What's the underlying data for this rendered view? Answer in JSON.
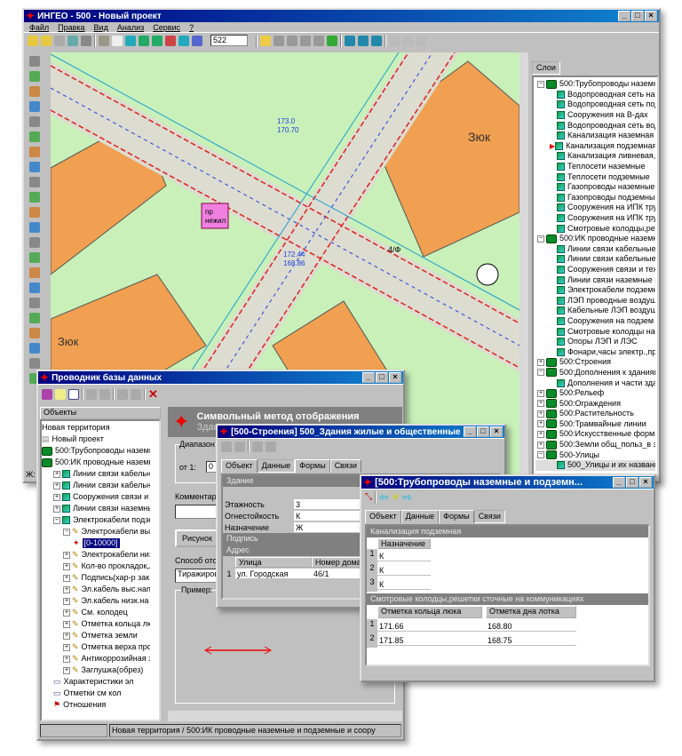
{
  "main_window": {
    "title": "ИНГЕО - 500 - Новый проект",
    "menu": [
      "Файл",
      "Правка",
      "Вид",
      "Анализ",
      "Сервис",
      "?"
    ],
    "scale_value": "522",
    "status_left": "Ж: 1"
  },
  "map": {
    "labels": [
      "Зюк",
      "Зюк",
      "пр",
      "нежил",
      "4/Ф",
      "173.0",
      "170.70",
      "172.44",
      "168.86"
    ],
    "colors": {
      "background": "#c8f0b8",
      "building": "#f0a050",
      "road": "#d8d8c8",
      "pipe": "#e02020",
      "network": "#2040e0"
    }
  },
  "layers_panel": {
    "tab": "Слои",
    "items": [
      {
        "label": "500:Трубопроводы наземные",
        "level": 0,
        "group": true
      },
      {
        "label": "Водопроводная сеть наз",
        "level": 1
      },
      {
        "label": "Водопроводная сеть под",
        "level": 1
      },
      {
        "label": "Сооружения на В-дах",
        "level": 1
      },
      {
        "label": "Водопроводная сеть вод",
        "level": 1
      },
      {
        "label": "Канализация наземная",
        "level": 1
      },
      {
        "label": "Канализация подземная",
        "level": 1,
        "flag": true
      },
      {
        "label": "Канализация ливневая,д",
        "level": 1
      },
      {
        "label": "Теплосети наземные",
        "level": 1
      },
      {
        "label": "Теплосети подземные",
        "level": 1
      },
      {
        "label": "Газопроводы наземные",
        "level": 1
      },
      {
        "label": "Газопроводы подземные",
        "level": 1
      },
      {
        "label": "Сооружения на ИПК труб",
        "level": 1
      },
      {
        "label": "Сооружения на ИПК труб",
        "level": 1
      },
      {
        "label": "Смотровые колодцы,реш",
        "level": 1
      },
      {
        "label": "500:ИК проводные наземные",
        "level": 0,
        "group": true
      },
      {
        "label": "Линии связи кабельные",
        "level": 1
      },
      {
        "label": "Линии связи кабельные",
        "level": 1
      },
      {
        "label": "Сооружения связи и тех",
        "level": 1
      },
      {
        "label": "Линии связи наземные г",
        "level": 1
      },
      {
        "label": "Электрокабели подземн",
        "level": 1
      },
      {
        "label": "ЛЭП проводные воздуш",
        "level": 1
      },
      {
        "label": "Кабельные ЛЭП воздуш",
        "level": 1
      },
      {
        "label": "Сооружения на подзем",
        "level": 1
      },
      {
        "label": "Смотровые колодцы на к",
        "level": 1
      },
      {
        "label": "Опоры ЛЭП и ЛЭС",
        "level": 1
      },
      {
        "label": "Фонари,часы электр.,пр",
        "level": 1
      },
      {
        "label": "500:Строения",
        "level": 0,
        "group": true
      },
      {
        "label": "500:Дополнения к зданиям,",
        "level": 0,
        "group": true
      },
      {
        "label": "Дополнения и части здан",
        "level": 1
      },
      {
        "label": "500:Рельеф",
        "level": 0,
        "group": true
      },
      {
        "label": "500:Ограждения",
        "level": 0,
        "group": true
      },
      {
        "label": "500:Растительность",
        "level": 0,
        "group": true
      },
      {
        "label": "500:Трамвайные линии",
        "level": 0,
        "group": true
      },
      {
        "label": "500:Искусственные формы р",
        "level": 0,
        "group": true
      },
      {
        "label": "500:Земли общ_польз_в зас",
        "level": 0,
        "group": true
      },
      {
        "label": "500-Улицы",
        "level": 0,
        "group": true
      },
      {
        "label": "500_Улицы и их названи",
        "level": 1,
        "selected": true
      }
    ]
  },
  "explorer": {
    "title": "Проводник базы данных",
    "tree_header": "Объекты",
    "tree": [
      {
        "label": "Новая территория",
        "level": 0,
        "icon": "none"
      },
      {
        "label": "Новый проект",
        "level": 0,
        "icon": "project"
      },
      {
        "label": "500:Трубопроводы наземн",
        "level": 0,
        "icon": "group"
      },
      {
        "label": "500:ИК проводные наземн",
        "level": 0,
        "icon": "group"
      },
      {
        "label": "Линии связи кабельн",
        "level": 1,
        "icon": "layer"
      },
      {
        "label": "Линии связи кабельн",
        "level": 1,
        "icon": "layer"
      },
      {
        "label": "Сооружения связи и те",
        "level": 1,
        "icon": "layer"
      },
      {
        "label": "Линии связи наземны",
        "level": 1,
        "icon": "layer"
      },
      {
        "label": "Электрокабели подзем",
        "level": 1,
        "icon": "layer"
      },
      {
        "label": "Электрокабели вы",
        "level": 2,
        "icon": "pen"
      },
      {
        "label": "[0-10000]",
        "level": 3,
        "icon": "star",
        "selected": true
      },
      {
        "label": "Электрокабели низ",
        "level": 2,
        "icon": "pen"
      },
      {
        "label": "Кол-во прокладок,л",
        "level": 2,
        "icon": "pen"
      },
      {
        "label": "Подпись(хар-р зак.",
        "level": 2,
        "icon": "pen"
      },
      {
        "label": "Эл.кабель выс.нап",
        "level": 2,
        "icon": "pen"
      },
      {
        "label": "Эл.кабель низк.на",
        "level": 2,
        "icon": "pen"
      },
      {
        "label": "См. колодец",
        "level": 2,
        "icon": "pen"
      },
      {
        "label": "Отметка кольца лю",
        "level": 2,
        "icon": "pen"
      },
      {
        "label": "Отметка земли",
        "level": 2,
        "icon": "pen"
      },
      {
        "label": "Отметка верха про",
        "level": 2,
        "icon": "pen"
      },
      {
        "label": "Антикоррозийная з",
        "level": 2,
        "icon": "pen"
      },
      {
        "label": "Заглушка(обрез)",
        "level": 2,
        "icon": "pen"
      },
      {
        "label": "Характеристики эл",
        "level": 1,
        "icon": "table"
      },
      {
        "label": "Отметки см кол",
        "level": 1,
        "icon": "table"
      },
      {
        "label": "Отношения",
        "level": 1,
        "icon": "rel"
      }
    ],
    "detail": {
      "title": "Символьный метод отображения",
      "subtitle": "Здания",
      "range_label": "Диапазон",
      "from_label": "от 1:",
      "from_value": "0",
      "comment_label": "Комментарий",
      "picture_button": "Рисунок",
      "method_label": "Способ отображения",
      "method_value": "Тиражирование",
      "example_label": "Пример:"
    },
    "status": "Новая территория / 500:ИК проводные наземные и подземные и соору"
  },
  "building_dialog": {
    "title": "[500-Строения] 500_Здания жилые и общественные",
    "tabs": [
      "Объект",
      "Данные",
      "Формы",
      "Связи"
    ],
    "active_tab": "Данные",
    "section_building": "Здание",
    "column_index": "1",
    "fields": [
      {
        "label": "Этажность",
        "value": "3"
      },
      {
        "label": "Огнестойкость",
        "value": "К"
      },
      {
        "label": "Назначение",
        "value": "Ж"
      }
    ],
    "section_label": "Подпись",
    "section_address": "Адрес",
    "address_columns": [
      "Улица",
      "Номер дома"
    ],
    "address_rows": [
      {
        "n": "1",
        "street": "ул. Городская",
        "house": "46/1"
      }
    ]
  },
  "pipe_dialog": {
    "title": "[500:Трубопроводы наземные и подземн...",
    "tabs": [
      "Объект",
      "Данные",
      "Формы",
      "Связи"
    ],
    "active_tab": "Связи",
    "section1": "Канализация подземная",
    "section1_column": "Назначение",
    "section1_rows": [
      {
        "n": "1",
        "v": "К"
      },
      {
        "n": "2",
        "v": "К"
      },
      {
        "n": "3",
        "v": "К"
      }
    ],
    "section2": "Смотровые колодцы,решетки сточные на коммуникациях",
    "section2_columns": [
      "Отметка кольца люка",
      "Отметка дна лотка"
    ],
    "section2_rows": [
      {
        "n": "1",
        "a": "171.66",
        "b": "168.80"
      },
      {
        "n": "2",
        "a": "171.85",
        "b": "168.75"
      }
    ]
  }
}
